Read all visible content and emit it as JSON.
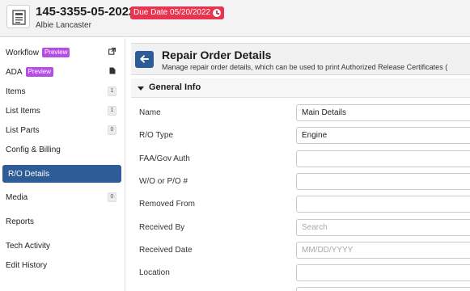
{
  "header": {
    "ro_number": "145-3355-05-2022",
    "due_badge": "Due Date 05/20/2022",
    "customer": "Albie Lancaster",
    "icons": {
      "document": "document-icon",
      "clock": "clock-icon"
    },
    "colors": {
      "due_badge": "#e8344e"
    }
  },
  "sidebar": {
    "items": [
      {
        "label": "Workflow",
        "badge": "Preview",
        "trail": "external-link-icon"
      },
      {
        "label": "ADA",
        "badge": "Preview",
        "trail": "file-icon"
      },
      {
        "label": "Items",
        "count": "1"
      },
      {
        "label": "List Items",
        "count": "1"
      },
      {
        "label": "List Parts",
        "count": "0"
      },
      {
        "label": "Config & Billing"
      },
      {
        "label": "R/O Details",
        "active": true
      },
      {
        "label": "Media",
        "count": "0"
      },
      {
        "label": "Reports"
      },
      {
        "label": "Tech Activity"
      },
      {
        "label": "Edit History"
      }
    ],
    "colors": {
      "active_bg": "#2d5c96",
      "preview_badge": "#b44ee6"
    }
  },
  "main": {
    "back_icon": "arrow-left-icon",
    "title": "Repair Order Details",
    "subtitle": "Manage repair order details, which can be used to print Authorized Release Certificates (",
    "section": {
      "title": "General Info",
      "icon": "caret-down-icon"
    },
    "fields": [
      {
        "label": "Name",
        "value": "Main Details",
        "placeholder": ""
      },
      {
        "label": "R/O Type",
        "value": "Engine",
        "placeholder": ""
      },
      {
        "label": "FAA/Gov Auth",
        "value": "",
        "placeholder": ""
      },
      {
        "label": "W/O or P/O #",
        "value": "",
        "placeholder": ""
      },
      {
        "label": "Removed From",
        "value": "",
        "placeholder": ""
      },
      {
        "label": "Received By",
        "value": "",
        "placeholder": "Search"
      },
      {
        "label": "Received Date",
        "value": "",
        "placeholder": "MM/DD/YYYY"
      },
      {
        "label": "Location",
        "value": "",
        "placeholder": ""
      }
    ]
  }
}
